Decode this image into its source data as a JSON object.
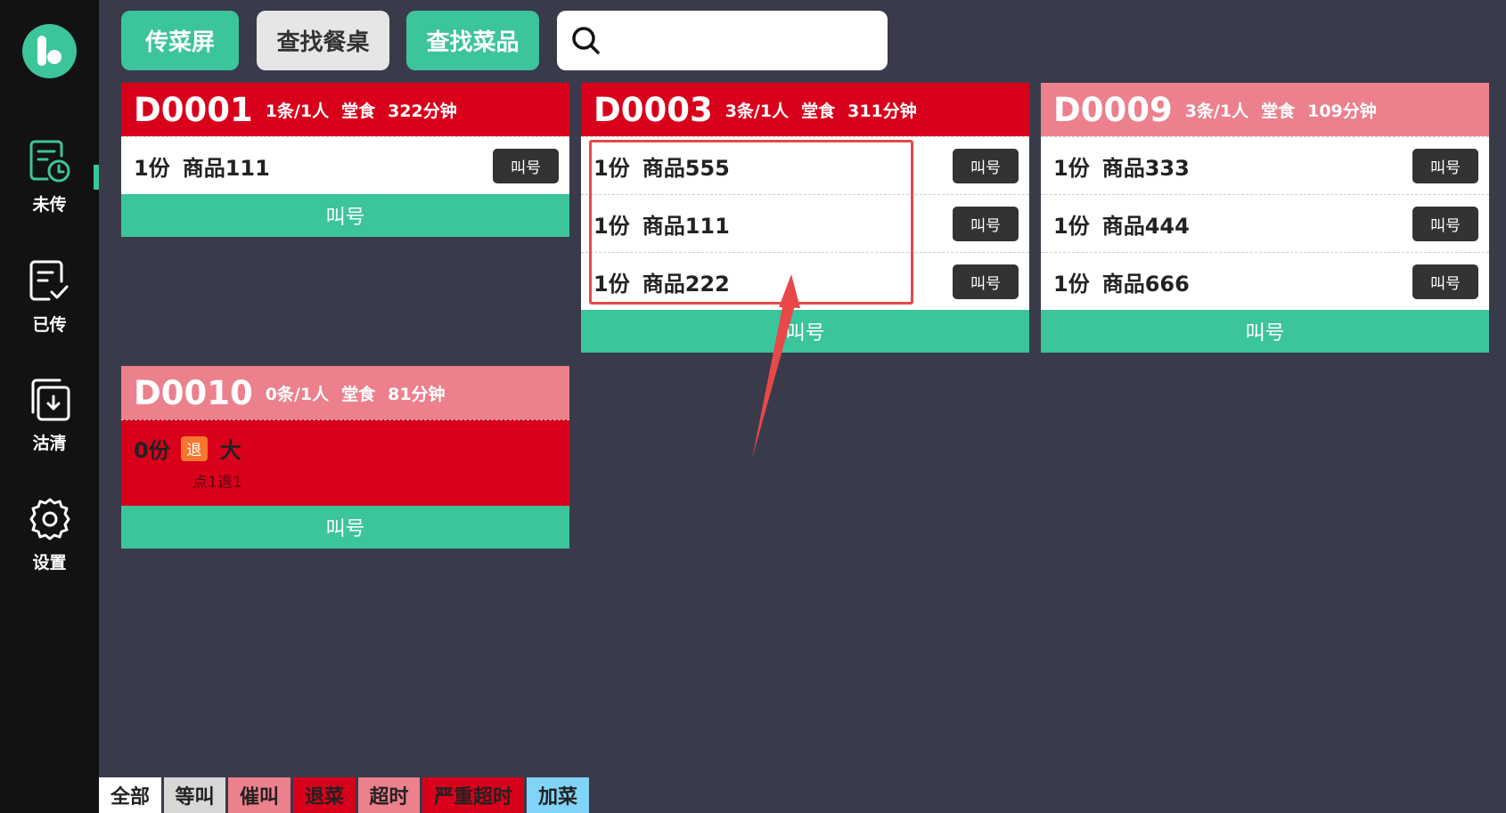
{
  "toolbar": {
    "pass_screen": "传菜屏",
    "find_table": "查找餐桌",
    "find_dish": "查找菜品",
    "search_placeholder": ""
  },
  "sidebar": {
    "items": [
      {
        "label": "未传",
        "icon": "clock-doc-icon",
        "active": true
      },
      {
        "label": "已传",
        "icon": "check-doc-icon"
      },
      {
        "label": "沽清",
        "icon": "download-box-icon"
      },
      {
        "label": "设置",
        "icon": "gear-icon"
      }
    ]
  },
  "cards": [
    {
      "code": "D0001",
      "count": "1条/1人",
      "type": "堂食",
      "time": "322分钟",
      "status": "red",
      "items": [
        {
          "qty": "1份",
          "name": "商品111",
          "call": "叫号"
        }
      ],
      "call_all": "叫号"
    },
    {
      "code": "D0003",
      "count": "3条/1人",
      "type": "堂食",
      "time": "311分钟",
      "status": "red",
      "items": [
        {
          "qty": "1份",
          "name": "商品555",
          "call": "叫号"
        },
        {
          "qty": "1份",
          "name": "商品111",
          "call": "叫号"
        },
        {
          "qty": "1份",
          "name": "商品222",
          "call": "叫号"
        }
      ],
      "call_all": "叫号"
    },
    {
      "code": "D0009",
      "count": "3条/1人",
      "type": "堂食",
      "time": "109分钟",
      "status": "pink",
      "items": [
        {
          "qty": "1份",
          "name": "商品333",
          "call": "叫号"
        },
        {
          "qty": "1份",
          "name": "商品444",
          "call": "叫号"
        },
        {
          "qty": "1份",
          "name": "商品666",
          "call": "叫号"
        }
      ],
      "call_all": "叫号"
    },
    {
      "code": "D0010",
      "count": "0条/1人",
      "type": "堂食",
      "time": "81分钟",
      "status": "pink",
      "cancel_item": {
        "qty": "0份",
        "badge": "退",
        "name": "大",
        "note": "点1退1"
      },
      "call_all": "叫号"
    }
  ],
  "legend": [
    {
      "label": "全部",
      "color": "#ffffff"
    },
    {
      "label": "等叫",
      "color": "#d7d7d7"
    },
    {
      "label": "催叫",
      "color": "#ec808d"
    },
    {
      "label": "退菜",
      "color": "#d9001b"
    },
    {
      "label": "超时",
      "color": "#ec808d"
    },
    {
      "label": "严重超时",
      "color": "#d9001b"
    },
    {
      "label": "加菜",
      "color": "#81d3f8"
    }
  ]
}
